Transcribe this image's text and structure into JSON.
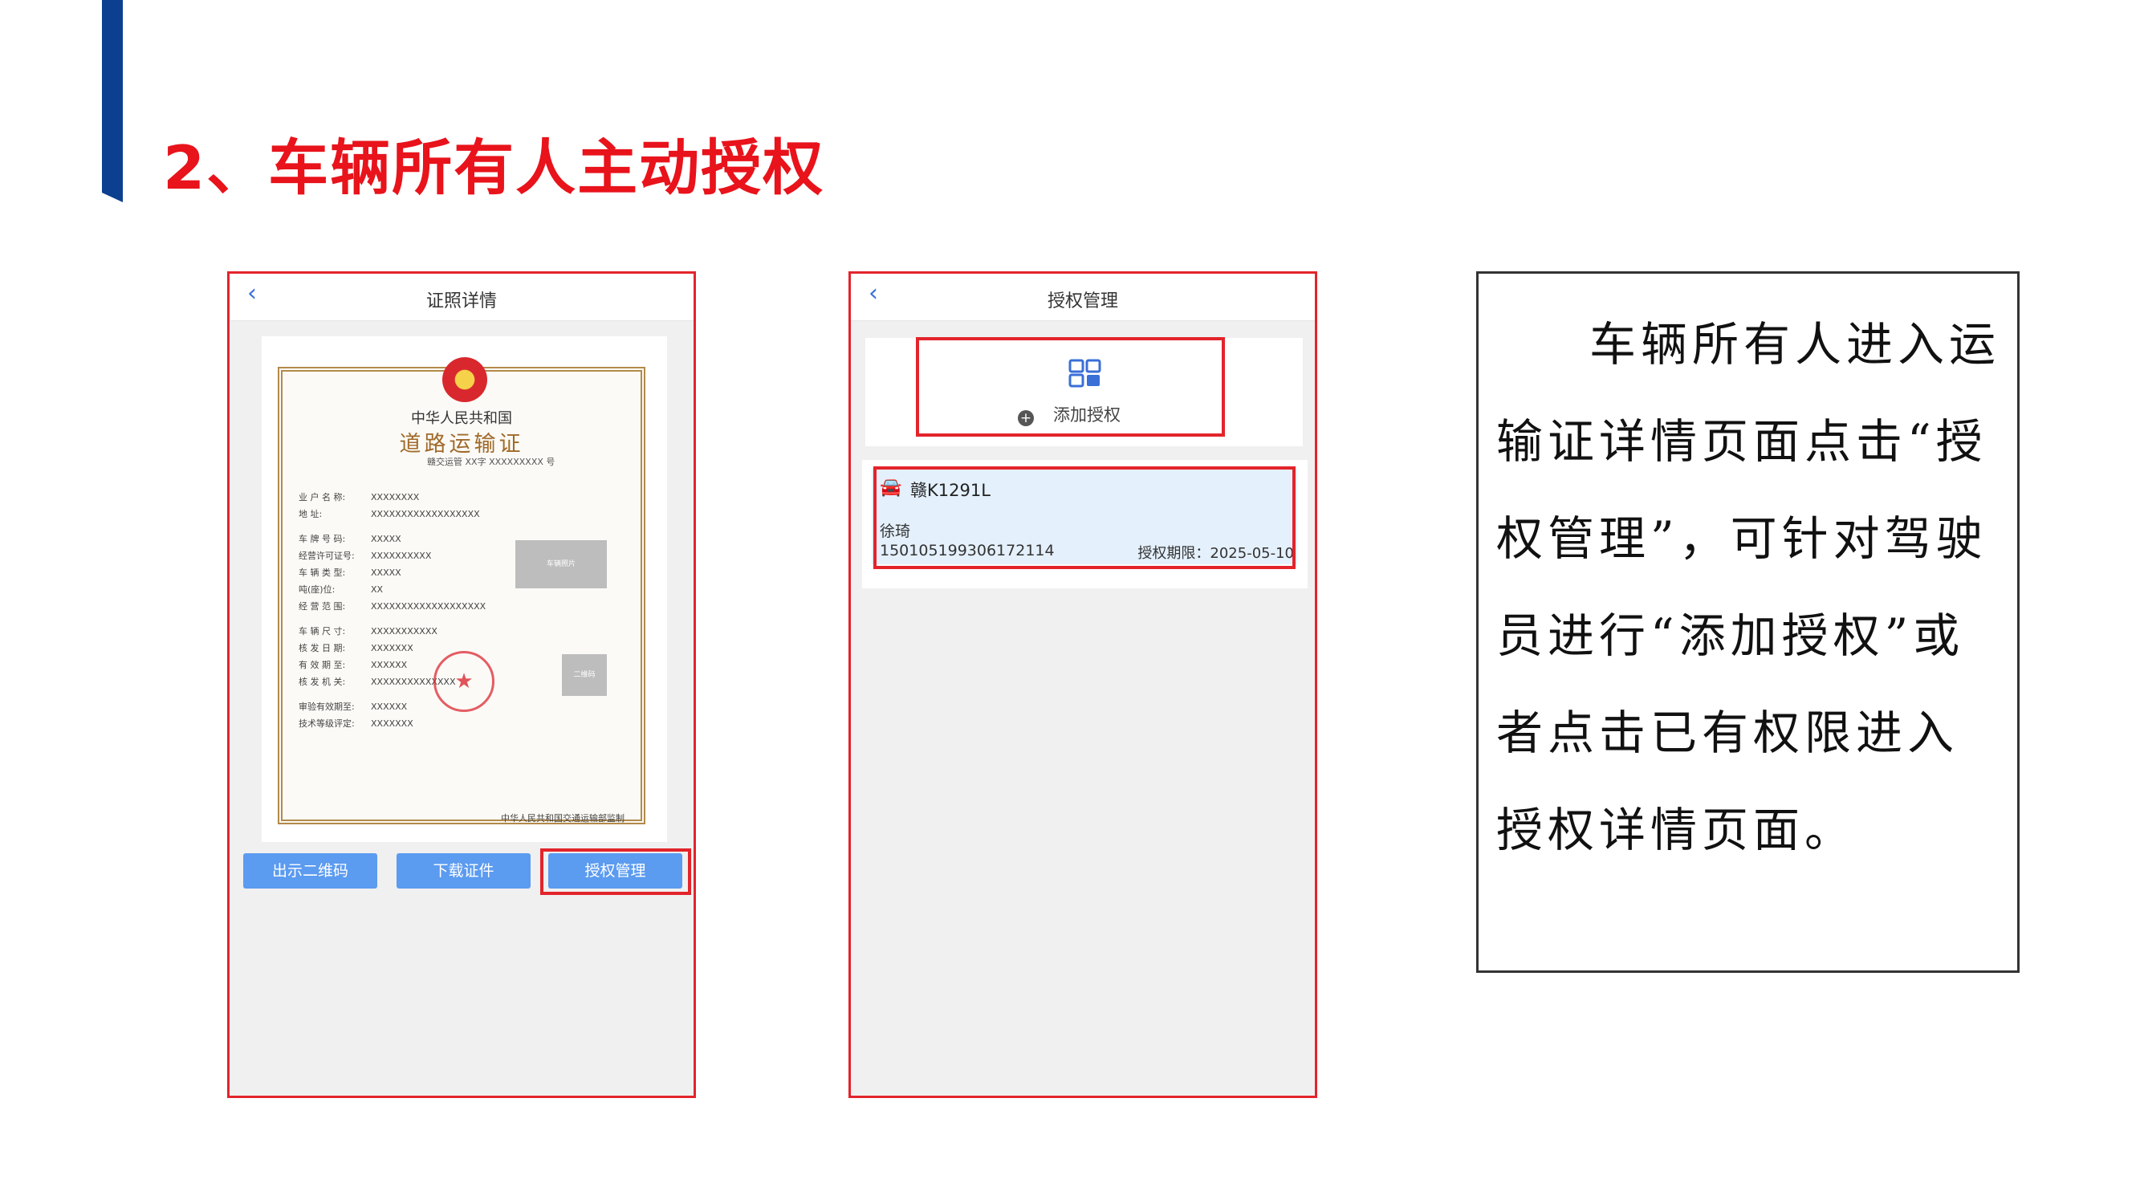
{
  "slide": {
    "title": "2、车辆所有人主动授权"
  },
  "phone1": {
    "title": "证照详情",
    "back_icon": "chevron-left-icon",
    "certificate": {
      "country": "中华人民共和国",
      "name": "道路运输证",
      "number_line": "赣交运管 XX字 XXXXXXXXX 号",
      "fields": [
        {
          "k": "业 户 名 称:",
          "v": "XXXXXXXX"
        },
        {
          "k": "地       址:",
          "v": "XXXXXXXXXXXXXXXXXX"
        },
        {
          "k": "车 牌 号 码:",
          "v": "XXXXX"
        },
        {
          "k": "经营许可证号:",
          "v": "XXXXXXXXXX"
        },
        {
          "k": "车 辆 类 型:",
          "v": "XXXXX"
        },
        {
          "k": "吨(座)位:",
          "v": "XX"
        },
        {
          "k": "经 营 范 围:",
          "v": "XXXXXXXXXXXXXXXXXXX"
        },
        {
          "k": "车 辆 尺 寸:",
          "v": "XXXXXXXXXXX"
        },
        {
          "k": "核 发 日 期:",
          "v": "XXXXXXX"
        },
        {
          "k": "有 效 期 至:",
          "v": "XXXXXX"
        },
        {
          "k": "核 发 机 关:",
          "v": "XXXXXXXXXXXXXX"
        },
        {
          "k": "审验有效期至:",
          "v": "XXXXXX"
        },
        {
          "k": "技术等级评定:",
          "v": "XXXXXXX"
        }
      ],
      "photo1_label": "车辆照片",
      "photo2_label": "二维码",
      "footer": "中华人民共和国交通运输部监制"
    },
    "buttons": {
      "show_qr": "出示二维码",
      "download": "下载证件",
      "auth_manage": "授权管理"
    }
  },
  "phone2": {
    "title": "授权管理",
    "back_icon": "chevron-left-icon",
    "add_label": "添加授权",
    "record": {
      "plate": "赣K1291L",
      "driver": "徐琦",
      "id_number": "150105199306172114",
      "expiry": "授权期限：2025-05-10"
    }
  },
  "description": "车辆所有人进入运输证详情页面点击“授权管理”，可针对驾驶员进行“添加授权”或者点击已有权限进入授权详情页面。",
  "colors": {
    "title_red": "#e8131b",
    "highlight_red": "#e3242b",
    "accent_blue": "#0d3f91",
    "button_blue": "#5b9bf0"
  }
}
